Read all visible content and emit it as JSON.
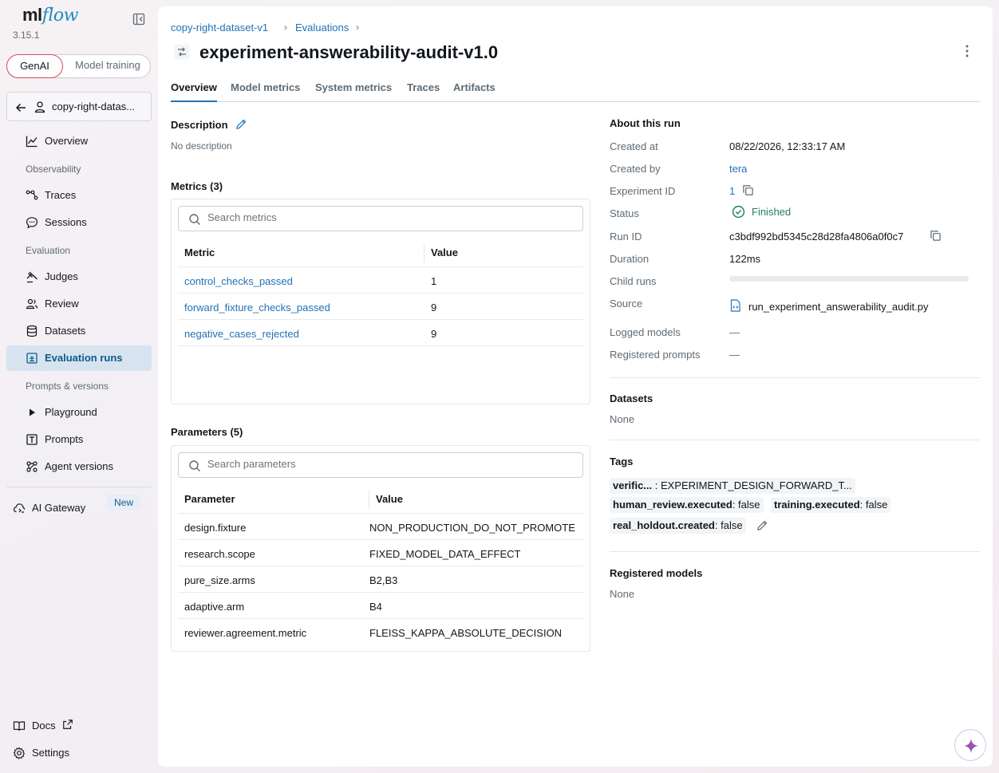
{
  "sidebar": {
    "logo_ml": "ml",
    "logo_flow": "flow",
    "version": "3.15.1",
    "mode_active": "GenAI",
    "mode_other": "Model training",
    "experiment": "copy-right-datas...",
    "overview": "Overview",
    "section_observability": "Observability",
    "traces": "Traces",
    "sessions": "Sessions",
    "section_evaluation": "Evaluation",
    "judges": "Judges",
    "review": "Review",
    "datasets": "Datasets",
    "evaluation_runs": "Evaluation runs",
    "section_prompts": "Prompts & versions",
    "playground": "Playground",
    "prompts": "Prompts",
    "agent_versions": "Agent versions",
    "ai_gateway": "AI Gateway",
    "new_badge": "New",
    "docs": "Docs",
    "settings": "Settings"
  },
  "header": {
    "breadcrumb": [
      "copy-right-dataset-v1",
      "Evaluations"
    ],
    "sep": "›",
    "title": "experiment-answerability-audit-v1.0"
  },
  "tabs": [
    "Overview",
    "Model metrics",
    "System metrics",
    "Traces",
    "Artifacts"
  ],
  "description": {
    "heading": "Description",
    "text": "No description"
  },
  "metrics": {
    "heading": "Metrics (3)",
    "search_placeholder": "Search metrics",
    "col_metric": "Metric",
    "col_value": "Value",
    "rows": [
      {
        "name": "control_checks_passed",
        "value": "1"
      },
      {
        "name": "forward_fixture_checks_passed",
        "value": "9"
      },
      {
        "name": "negative_cases_rejected",
        "value": "9"
      }
    ]
  },
  "parameters": {
    "heading": "Parameters (5)",
    "search_placeholder": "Search parameters",
    "col_param": "Parameter",
    "col_value": "Value",
    "rows": [
      {
        "name": "design.fixture",
        "value": "NON_PRODUCTION_DO_NOT_PROMOTE"
      },
      {
        "name": "research.scope",
        "value": "FIXED_MODEL_DATA_EFFECT"
      },
      {
        "name": "pure_size.arms",
        "value": "B2,B3"
      },
      {
        "name": "adaptive.arm",
        "value": "B4"
      },
      {
        "name": "reviewer.agreement.metric",
        "value": "FLEISS_KAPPA_ABSOLUTE_DECISION"
      }
    ]
  },
  "about": {
    "heading": "About this run",
    "created_at_label": "Created at",
    "created_at": "08/22/2026, 12:33:17 AM",
    "created_by_label": "Created by",
    "created_by": "tera",
    "experiment_id_label": "Experiment ID",
    "experiment_id": "1",
    "status_label": "Status",
    "status": "Finished",
    "run_id_label": "Run ID",
    "run_id": "c3bdf992bd5345c28d28fa4806a0f0c7",
    "duration_label": "Duration",
    "duration": "122ms",
    "child_runs_label": "Child runs",
    "source_label": "Source",
    "source": "run_experiment_answerability_audit.py",
    "logged_models_label": "Logged models",
    "logged_models": "—",
    "registered_prompts_label": "Registered prompts",
    "registered_prompts": "—"
  },
  "datasets": {
    "heading": "Datasets",
    "value": "None"
  },
  "tags": {
    "heading": "Tags",
    "items": [
      {
        "key": "verific...",
        "value": " : EXPERIMENT_DESIGN_FORWARD_T..."
      },
      {
        "key": "human_review.executed",
        "value": ": false"
      },
      {
        "key": "training.executed",
        "value": ": false"
      },
      {
        "key": "real_holdout.created",
        "value": ": false"
      }
    ]
  },
  "registered_models": {
    "heading": "Registered models",
    "value": "None"
  },
  "colors": {
    "accent": "#2272b4",
    "success": "#24815b",
    "active_nav_bg": "#d7e4f0"
  }
}
